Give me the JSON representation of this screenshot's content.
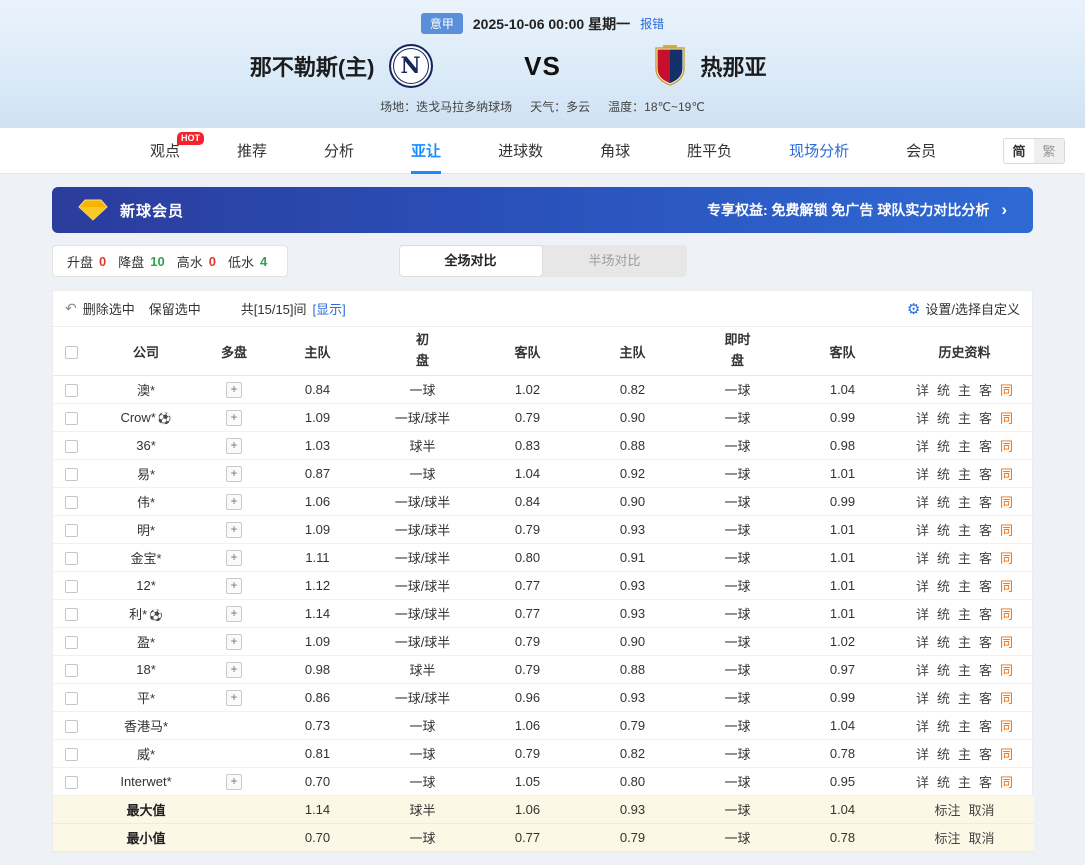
{
  "header": {
    "league": "意甲",
    "datetime": "2025-10-06 00:00 星期一",
    "report_error": "报错",
    "home_team": "那不勒斯(主)",
    "home_logo_letter": "N",
    "vs": "VS",
    "away_team": "热那亚",
    "venue": "场地：迭戈马拉多纳球场",
    "weather": "天气：多云",
    "temperature": "温度：18℃~19℃"
  },
  "nav": {
    "items": [
      {
        "key": "viewpoint",
        "label": "观点",
        "hot": "HOT"
      },
      {
        "key": "recommend",
        "label": "推荐"
      },
      {
        "key": "analysis",
        "label": "分析"
      },
      {
        "key": "asian-handicap",
        "label": "亚让",
        "active": true
      },
      {
        "key": "goals",
        "label": "进球数"
      },
      {
        "key": "corners",
        "label": "角球"
      },
      {
        "key": "win-draw-lose",
        "label": "胜平负"
      },
      {
        "key": "live-analysis",
        "label": "现场分析",
        "highlight": true
      },
      {
        "key": "member",
        "label": "会员"
      }
    ],
    "lang": [
      "简",
      "繁"
    ]
  },
  "banner": {
    "title": "新球会员",
    "benefits": "专享权益: 免费解锁 免广告 球队实力对比分析",
    "arrow": "›"
  },
  "filters": {
    "stats": [
      {
        "label": "升盘",
        "value": "0",
        "color": "#e0392f"
      },
      {
        "label": "降盘",
        "value": "10",
        "color": "#2fa14f"
      },
      {
        "label": "高水",
        "value": "0",
        "color": "#e0392f"
      },
      {
        "label": "低水",
        "value": "4",
        "color": "#2fa14f"
      }
    ],
    "tabs": [
      {
        "key": "full-match",
        "label": "全场对比",
        "active": true
      },
      {
        "key": "half-match",
        "label": "半场对比",
        "active": false
      }
    ]
  },
  "controls": {
    "delete_selected": "删除选中",
    "keep_selected": "保留选中",
    "count": "共[15/15]间",
    "show": "[显示]",
    "settings": "设置/选择自定义"
  },
  "table": {
    "head": {
      "company": "公司",
      "multi": "多盘",
      "home": "主队",
      "away": "客队",
      "init_top": "初",
      "live_top": "即时",
      "pan": "盘",
      "history": "历史资料"
    },
    "history_links": [
      "详",
      "统",
      "主",
      "客",
      "同"
    ],
    "rows": [
      {
        "company": "澳*",
        "multi": true,
        "ball": false,
        "values": [
          "0.84",
          "一球",
          "1.02",
          "0.82",
          "一球",
          "1.04"
        ]
      },
      {
        "company": "Crow*",
        "multi": true,
        "ball": true,
        "values": [
          "1.09",
          "一球/球半",
          "0.79",
          "0.90",
          "一球",
          "0.99"
        ]
      },
      {
        "company": "36*",
        "multi": true,
        "ball": false,
        "values": [
          "1.03",
          "球半",
          "0.83",
          "0.88",
          "一球",
          "0.98"
        ]
      },
      {
        "company": "易*",
        "multi": true,
        "ball": false,
        "values": [
          "0.87",
          "一球",
          "1.04",
          "0.92",
          "一球",
          "1.01"
        ]
      },
      {
        "company": "伟*",
        "multi": true,
        "ball": false,
        "values": [
          "1.06",
          "一球/球半",
          "0.84",
          "0.90",
          "一球",
          "0.99"
        ]
      },
      {
        "company": "明*",
        "multi": true,
        "ball": false,
        "values": [
          "1.09",
          "一球/球半",
          "0.79",
          "0.93",
          "一球",
          "1.01"
        ]
      },
      {
        "company": "金宝*",
        "multi": true,
        "ball": false,
        "values": [
          "1.11",
          "一球/球半",
          "0.80",
          "0.91",
          "一球",
          "1.01"
        ]
      },
      {
        "company": "12*",
        "multi": true,
        "ball": false,
        "values": [
          "1.12",
          "一球/球半",
          "0.77",
          "0.93",
          "一球",
          "1.01"
        ]
      },
      {
        "company": "利*",
        "multi": true,
        "ball": true,
        "values": [
          "1.14",
          "一球/球半",
          "0.77",
          "0.93",
          "一球",
          "1.01"
        ]
      },
      {
        "company": "盈*",
        "multi": true,
        "ball": false,
        "values": [
          "1.09",
          "一球/球半",
          "0.79",
          "0.90",
          "一球",
          "1.02"
        ]
      },
      {
        "company": "18*",
        "multi": true,
        "ball": false,
        "values": [
          "0.98",
          "球半",
          "0.79",
          "0.88",
          "一球",
          "0.97"
        ]
      },
      {
        "company": "平*",
        "multi": true,
        "ball": false,
        "values": [
          "0.86",
          "一球/球半",
          "0.96",
          "0.93",
          "一球",
          "0.99"
        ]
      },
      {
        "company": "香港马*",
        "multi": false,
        "ball": false,
        "values": [
          "0.73",
          "一球",
          "1.06",
          "0.79",
          "一球",
          "1.04"
        ]
      },
      {
        "company": "威*",
        "multi": false,
        "ball": false,
        "values": [
          "0.81",
          "一球",
          "0.79",
          "0.82",
          "一球",
          "0.78"
        ]
      },
      {
        "company": "Interwet*",
        "multi": true,
        "ball": false,
        "values": [
          "0.70",
          "一球",
          "1.05",
          "0.80",
          "一球",
          "0.95"
        ]
      }
    ],
    "footer": [
      {
        "label": "最大值",
        "values": [
          "1.14",
          "球半",
          "1.06",
          "0.93",
          "一球",
          "1.04"
        ],
        "links": [
          "标注",
          "取消"
        ]
      },
      {
        "label": "最小值",
        "values": [
          "0.70",
          "一球",
          "0.77",
          "0.79",
          "一球",
          "0.78"
        ],
        "links": [
          "标注",
          "取消"
        ]
      }
    ]
  }
}
